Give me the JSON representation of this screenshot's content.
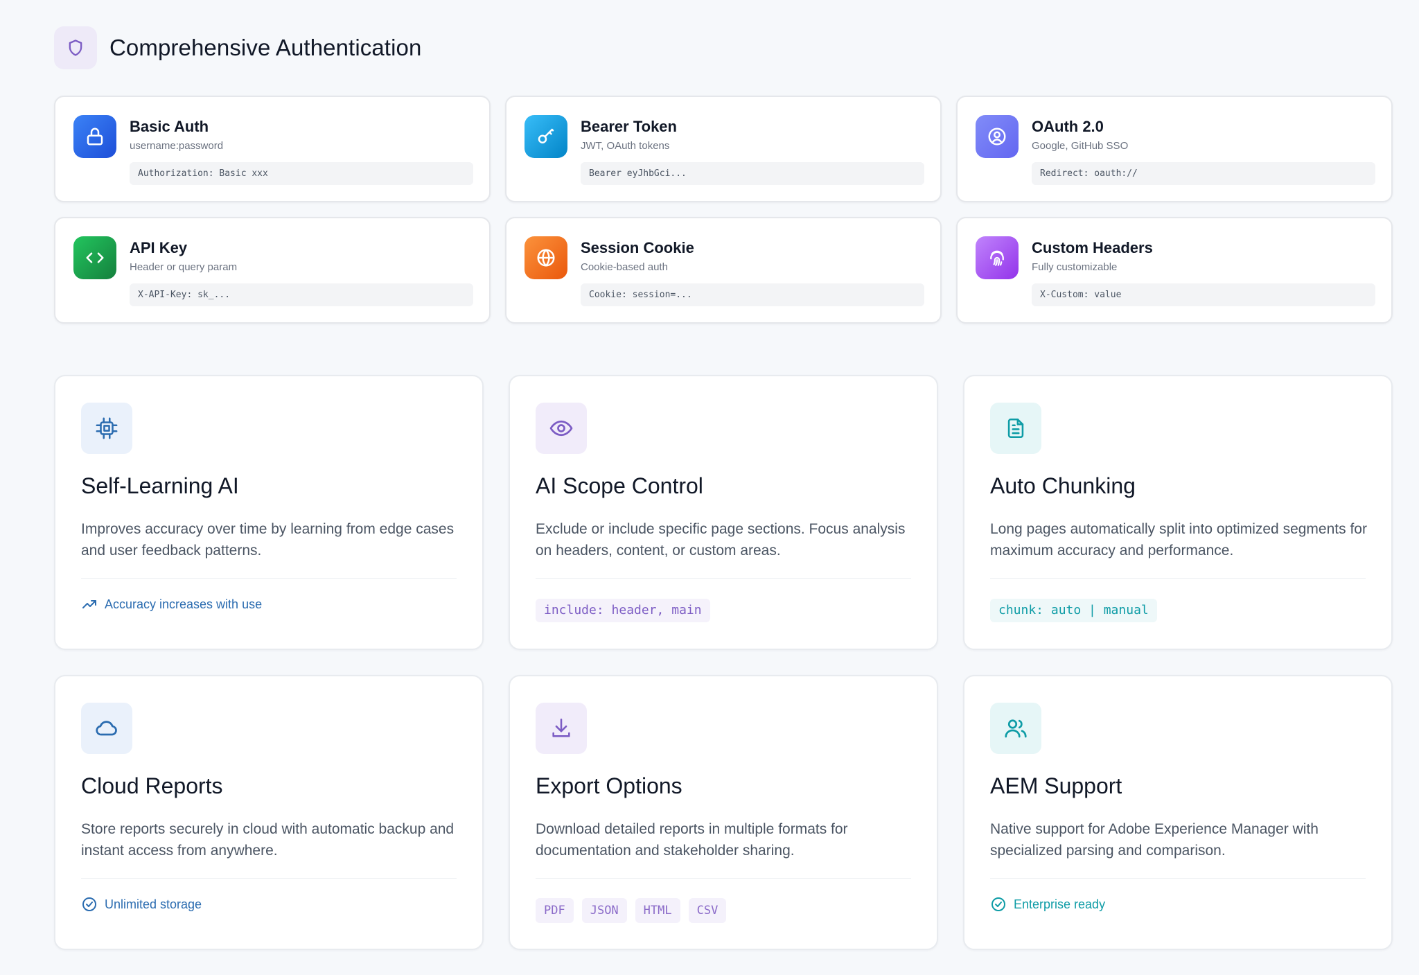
{
  "header": {
    "title": "Comprehensive Authentication",
    "icon": "shield-icon"
  },
  "auth_methods": [
    {
      "name": "Basic Auth",
      "sub": "username:password",
      "code": "Authorization: Basic xxx",
      "icon": "lock-icon",
      "color": "#2563eb"
    },
    {
      "name": "Bearer Token",
      "sub": "JWT, OAuth tokens",
      "code": "Bearer eyJhbGci...",
      "icon": "key-icon",
      "color": "#0ea5e9"
    },
    {
      "name": "OAuth 2.0",
      "sub": "Google, GitHub SSO",
      "code": "Redirect: oauth://",
      "icon": "user-circle-icon",
      "color": "#6366f1"
    },
    {
      "name": "API Key",
      "sub": "Header or query param",
      "code": "X-API-Key: sk_...",
      "icon": "code-icon",
      "color": "#16a34a"
    },
    {
      "name": "Session Cookie",
      "sub": "Cookie-based auth",
      "code": "Cookie: session=...",
      "icon": "globe-icon",
      "color": "#f97316"
    },
    {
      "name": "Custom Headers",
      "sub": "Fully customizable",
      "code": "X-Custom: value",
      "icon": "fingerprint-icon",
      "color": "#a855f7"
    }
  ],
  "features": [
    {
      "title": "Self-Learning AI",
      "desc": "Improves accuracy over time by learning from edge cases and user feedback patterns.",
      "icon": "cpu-icon",
      "footer": "Accuracy increases with use",
      "footer_icon": "trending-up-icon",
      "accent": "#2b6cb0"
    },
    {
      "title": "AI Scope Control",
      "desc": "Exclude or include specific page sections. Focus analysis on headers, content, or custom areas.",
      "icon": "eye-icon",
      "code": "include: header, main",
      "accent": "#7c5cc4"
    },
    {
      "title": "Auto Chunking",
      "desc": "Long pages automatically split into optimized segments for maximum accuracy and performance.",
      "icon": "document-icon",
      "code": "chunk: auto | manual",
      "accent": "#0e9ca6"
    },
    {
      "title": "Cloud Reports",
      "desc": "Store reports securely in cloud with automatic backup and instant access from anywhere.",
      "icon": "cloud-icon",
      "footer": "Unlimited storage",
      "footer_icon": "check-circle-icon",
      "accent": "#2b6cb0"
    },
    {
      "title": "Export Options",
      "desc": "Download detailed reports in multiple formats for documentation and stakeholder sharing.",
      "icon": "download-icon",
      "formats": [
        "PDF",
        "JSON",
        "HTML",
        "CSV"
      ],
      "accent": "#7c5cc4"
    },
    {
      "title": "AEM Support",
      "desc": "Native support for Adobe Experience Manager with specialized parsing and comparison.",
      "icon": "users-icon",
      "footer": "Enterprise ready",
      "footer_icon": "check-circle-icon",
      "accent": "#0e9ca6"
    }
  ]
}
